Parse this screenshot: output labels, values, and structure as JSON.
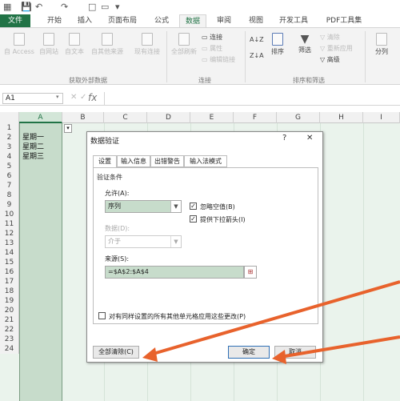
{
  "qat": {
    "icons": [
      "save-icon",
      "undo-icon",
      "redo-icon",
      "new-icon",
      "open-icon",
      "customize-icon"
    ]
  },
  "tabs": [
    {
      "label": "文件"
    },
    {
      "label": "开始"
    },
    {
      "label": "插入"
    },
    {
      "label": "页面布局"
    },
    {
      "label": "公式"
    },
    {
      "label": "数据"
    },
    {
      "label": "审阅"
    },
    {
      "label": "视图"
    },
    {
      "label": "开发工具"
    },
    {
      "label": "PDF工具集"
    }
  ],
  "ribbon": {
    "external": {
      "access": "自 Access",
      "web": "自网站",
      "text": "自文本",
      "other": "自其他来源",
      "existing": "现有连接",
      "group": "获取外部数据"
    },
    "connections": {
      "refresh": "全部刷新",
      "conn": "连接",
      "props": "属性",
      "edit_links": "编辑链接",
      "group": "连接"
    },
    "sort": {
      "sort": "排序",
      "filter": "筛选",
      "clear": "清除",
      "reapply": "重新应用",
      "advanced": "高级",
      "group": "排序和筛选"
    },
    "outline": {
      "split": "分列"
    }
  },
  "formula_bar": {
    "name_box": "A1",
    "fx": "fx"
  },
  "sheet": {
    "columns": [
      "A",
      "B",
      "C",
      "D",
      "E",
      "F",
      "G",
      "H",
      "I"
    ],
    "rows": [
      "1",
      "2",
      "3",
      "4",
      "5",
      "6",
      "7",
      "8",
      "9",
      "10",
      "11",
      "12",
      "13",
      "14",
      "15",
      "16",
      "17",
      "18",
      "19",
      "20",
      "21",
      "22",
      "23",
      "24"
    ],
    "cells": [
      "星期一",
      "星期二",
      "星期三"
    ]
  },
  "dialog": {
    "title": "数据验证",
    "help": "?",
    "close": "✕",
    "tabs": [
      "设置",
      "输入信息",
      "出错警告",
      "输入法模式"
    ],
    "criteria_label": "验证条件",
    "allow_label": "允许(A):",
    "allow_value": "序列",
    "ignore_blank": "忽略空值(B)",
    "dropdown": "提供下拉箭头(I)",
    "data_label": "数据(D):",
    "data_value": "介于",
    "source_label": "来源(S):",
    "source_value": "=$A$2:$A$4",
    "apply_all": "对有同样设置的所有其他单元格应用这些更改(P)",
    "clear_all": "全部清除(C)",
    "ok": "确定",
    "cancel": "取消"
  },
  "colors": {
    "excel_green": "#217346",
    "arrow": "#e8622c",
    "selection": "#c7dccb"
  }
}
